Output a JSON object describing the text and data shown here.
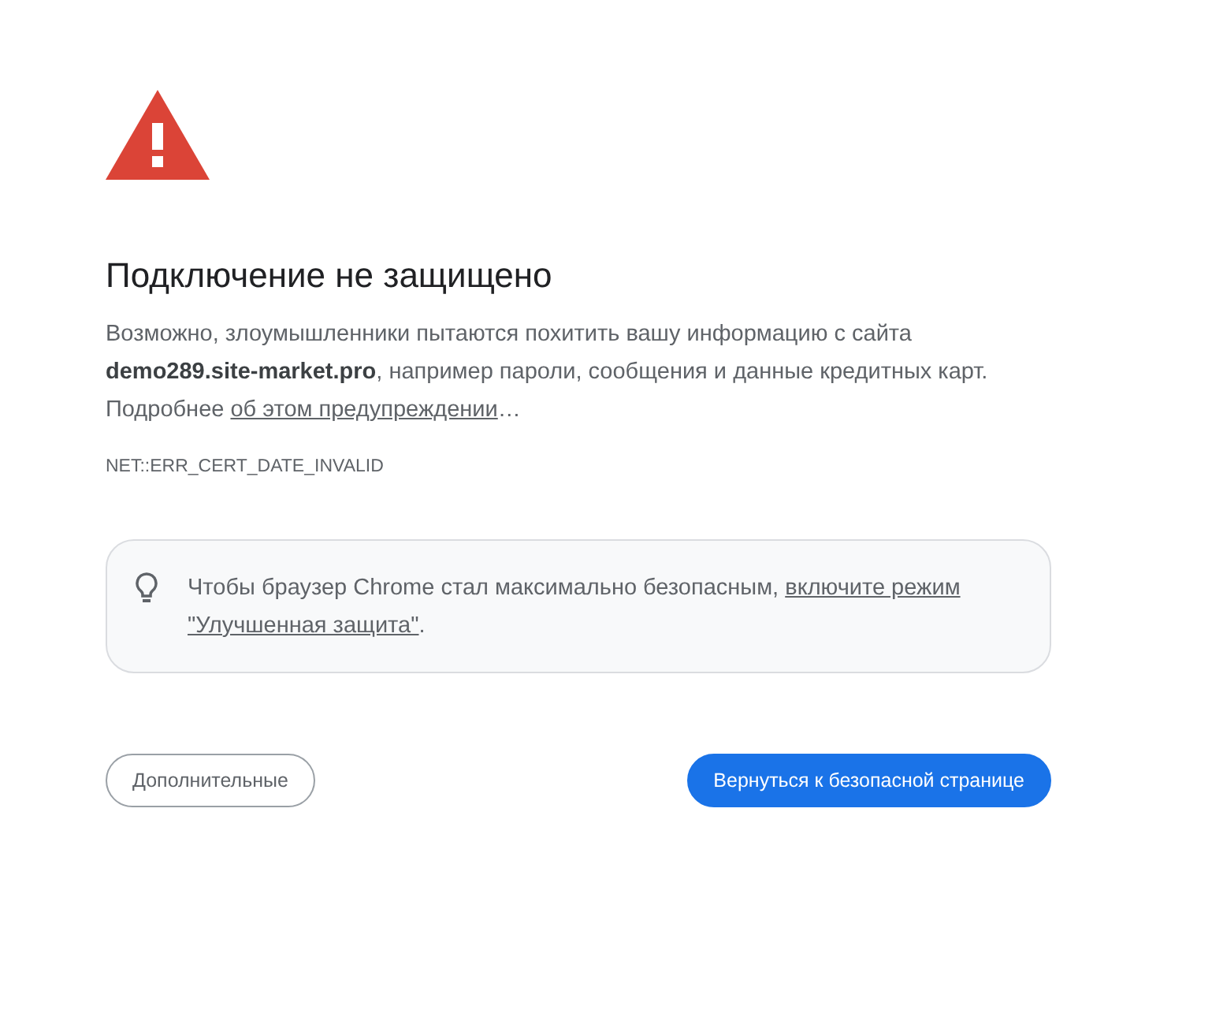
{
  "heading": "Подключение не защищено",
  "explanation": {
    "text": "Возможно, злоумышленники пытаются похитить вашу информацию с сайта **demo289.site-market.pro**, например пароли, сообщения и данные кредитных карт. Подробнее ",
    "link": "об этом предупреждении",
    "suffix": "…"
  },
  "error_code": "NET::ERR_CERT_DATE_INVALID",
  "tip": {
    "text": "Чтобы браузер Chrome стал максимально безопасным, ",
    "link_lines": [
      "включите режим",
      "\"Улучшенная защита\""
    ],
    "suffix": "."
  },
  "buttons": [
    {
      "label": "Дополнительные",
      "kind": "secondary"
    },
    {
      "label": "Вернуться к безопасной странице",
      "kind": "primary"
    }
  ]
}
